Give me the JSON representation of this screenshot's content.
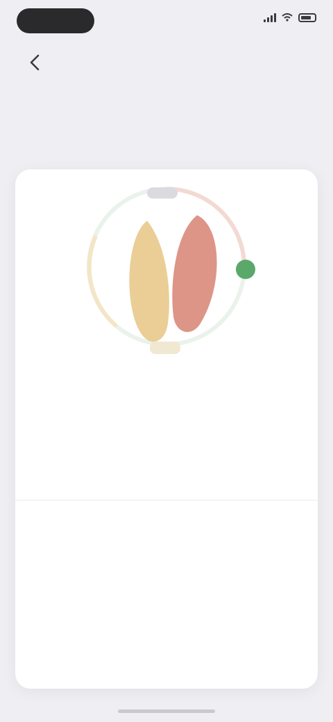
{
  "status_bar": {
    "time": "",
    "icons": [
      "cellular-signal-icon",
      "wifi-icon",
      "battery-icon"
    ]
  },
  "nav": {
    "title": "",
    "back_icon": "chevron-left-icon"
  },
  "card": {
    "illustration": "digestive-organs-illustration",
    "status_label": "",
    "description": "",
    "detail_link": {
      "prefix": "",
      "label": ""
    },
    "metrics": [
      {
        "label": "",
        "value": "",
        "sub": ""
      },
      {
        "label": "",
        "value": "",
        "sub": ""
      },
      {
        "label": "",
        "value": "",
        "sub": ""
      }
    ]
  },
  "colors": {
    "background": "#EFEFF3",
    "card": "#FFFFFF",
    "status_accent": "#2F6F8A",
    "organ_left": "#E8C98A",
    "organ_right": "#D9897A",
    "ring_accent": "#5BA86B"
  }
}
